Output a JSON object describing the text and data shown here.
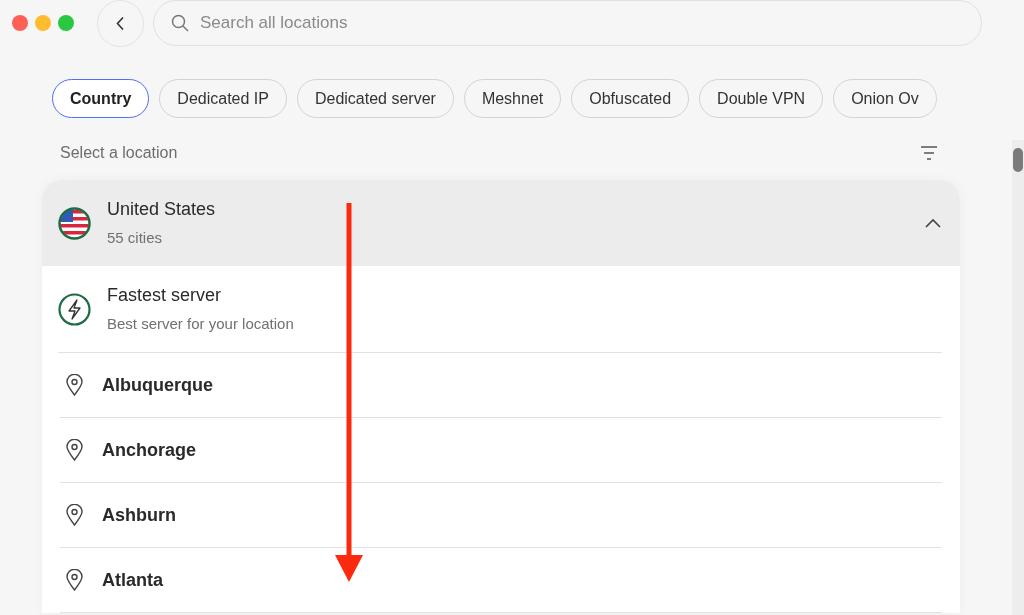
{
  "search": {
    "placeholder": "Search all locations"
  },
  "filters": [
    {
      "label": "Country",
      "selected": true
    },
    {
      "label": "Dedicated IP",
      "selected": false
    },
    {
      "label": "Dedicated server",
      "selected": false
    },
    {
      "label": "Meshnet",
      "selected": false
    },
    {
      "label": "Obfuscated",
      "selected": false
    },
    {
      "label": "Double VPN",
      "selected": false
    },
    {
      "label": "Onion Ov",
      "selected": false
    }
  ],
  "section_label": "Select a location",
  "country": {
    "name": "United States",
    "subtitle": "55 cities",
    "expanded": true,
    "items": [
      {
        "kind": "fastest",
        "title": "Fastest server",
        "subtitle": "Best server for your location"
      },
      {
        "kind": "city",
        "title": "Albuquerque"
      },
      {
        "kind": "city",
        "title": "Anchorage"
      },
      {
        "kind": "city",
        "title": "Ashburn"
      },
      {
        "kind": "city",
        "title": "Atlanta"
      }
    ]
  }
}
